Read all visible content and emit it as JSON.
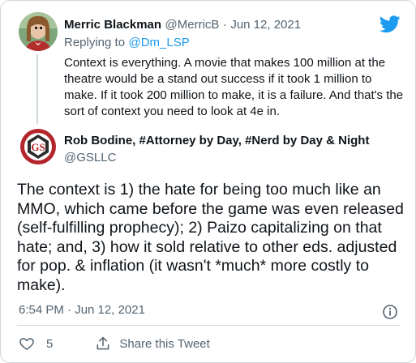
{
  "reply_tweet": {
    "author_name": "Merric Blackman",
    "handle": "@MerricB",
    "separator": "·",
    "date": "Jun 12, 2021",
    "replying_to_label": "Replying to",
    "replying_to_handle": "@Dm_LSP",
    "text": "Context is everything. A movie that makes 100 million at the theatre would be a stand out success if it took 1 million to make. If it took 200 million to make, it is a failure. And that's the sort of context you need to look at 4e in."
  },
  "main_tweet": {
    "author_name": "Rob Bodine, #Attorney by Day, #Nerd by Day & Night",
    "handle": "@GSLLC",
    "text": "The context is 1) the hate for being too much like an MMO, which came before the game was even released (self-fulfilling prophecy); 2) Paizo capitalizing on that hate; and, 3) how it sold relative to other eds. adjusted for pop. & inflation (it wasn't *much* more costly to make).",
    "timestamp": "6:54 PM · Jun 12, 2021"
  },
  "actions": {
    "like_count": "5",
    "share_label": "Share this Tweet"
  },
  "icons": {
    "brand": "twitter-bird-icon",
    "info": "info-icon",
    "like": "heart-icon",
    "share": "share-icon"
  },
  "colors": {
    "brand_blue": "#1d9bf0",
    "muted_gray": "#536471",
    "border": "#cfd9de",
    "author_logo_red": "#b3262b"
  }
}
